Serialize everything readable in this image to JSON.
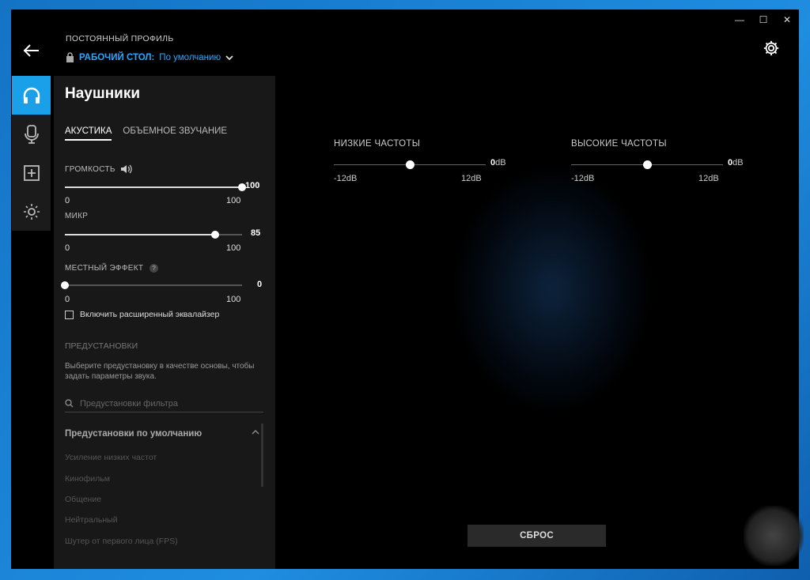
{
  "window": {
    "controls": [
      "—",
      "☐",
      "✕"
    ]
  },
  "header": {
    "profile_label": "ПОСТОЯННЫЙ ПРОФИЛЬ",
    "profile_group": "РАБОЧИЙ СТОЛ:",
    "profile_name": "По умолчанию"
  },
  "rail": {
    "items": [
      "headphones-icon",
      "microphone-icon",
      "plus-box-icon",
      "lighting-icon"
    ]
  },
  "panel": {
    "title": "Наушники",
    "tabs": [
      "АКУСТИКА",
      "ОБЪЕМНОЕ ЗВУЧАНИЕ"
    ],
    "volume": {
      "label": "ГРОМКОСТЬ",
      "value": "100",
      "min": "0",
      "max": "100",
      "level": 1.0
    },
    "mic": {
      "label": "МИКР",
      "value": "85",
      "min": "0",
      "max": "100",
      "level": 0.85
    },
    "sidetone": {
      "label": "МЕСТНЫЙ ЭФФЕКТ",
      "help": "?",
      "value": "0",
      "min": "0",
      "max": "100",
      "level": 0.0
    },
    "advanced_eq": "Включить расширенный эквалайзер",
    "presets": {
      "title": "ПРЕДУСТАНОВКИ",
      "description": "Выберите предустановку в качестве основы, чтобы задать параметры звука.",
      "filter_placeholder": "Предустановки фильтра",
      "group": "Предустановки по умолчанию",
      "items": [
        "Усиление низких частот",
        "Кинофильм",
        "Общение",
        "Нейтральный",
        "Шутер от первого лица (FPS)"
      ]
    }
  },
  "eq": {
    "bass": {
      "label": "НИЗКИЕ ЧАСТОТЫ",
      "value": "0",
      "unit": "dB",
      "min": "-12dB",
      "max": "12dB",
      "level": 0.5
    },
    "treble": {
      "label": "ВЫСОКИЕ ЧАСТОТЫ",
      "value": "0",
      "unit": "dB",
      "min": "-12dB",
      "max": "12dB",
      "level": 0.5
    }
  },
  "reset_label": "СБРОС",
  "colors": {
    "accent": "#1aa0e8",
    "link": "#2aa7ff",
    "background": "#000000"
  }
}
